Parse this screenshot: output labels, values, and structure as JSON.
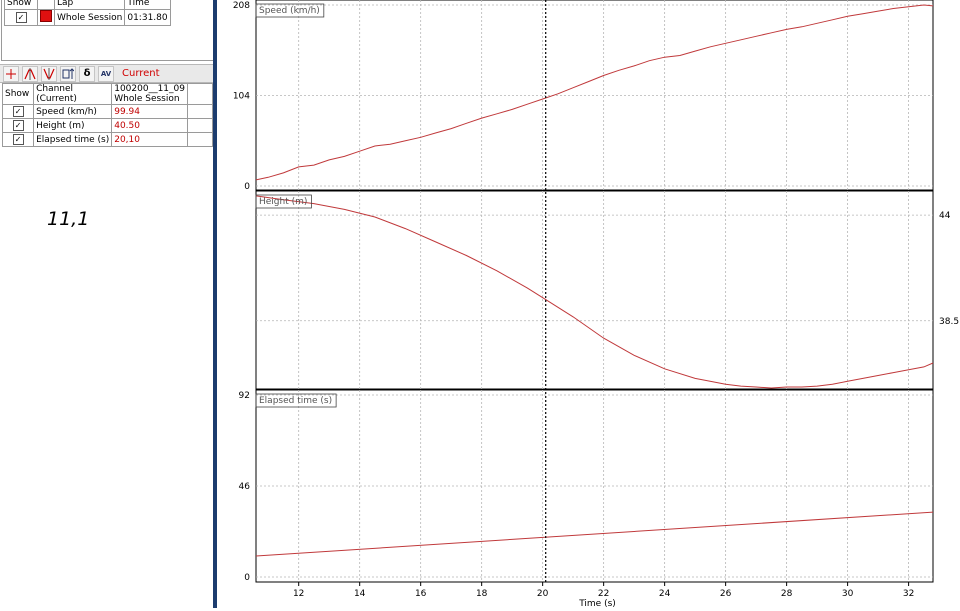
{
  "laps": {
    "headers": {
      "show": "Show",
      "lap": "Lap",
      "time": "Time"
    },
    "rows": [
      {
        "show": true,
        "color": "#e01010",
        "lap": "Whole Session",
        "time": "01:31.80"
      }
    ]
  },
  "toolbar": {
    "current_label": "Current",
    "delta_symbol": "δ",
    "av_symbol": "AV"
  },
  "channels": {
    "headers": {
      "show": "Show",
      "channel_line1": "Channel",
      "channel_line2": "(Current)",
      "session_line1": "100200__11_09",
      "session_line2": "Whole Session"
    },
    "rows": [
      {
        "name": "Speed (km/h)",
        "value": "99.94"
      },
      {
        "name": "Height (m)",
        "value": "40.50"
      },
      {
        "name": "Elapsed time (s)",
        "value": "20,10"
      }
    ]
  },
  "note": "11,1",
  "colors": {
    "trace": "#c0393b",
    "accent_divider": "#1c3c6e"
  },
  "chart_data": {
    "type": "line",
    "xlabel": "Time (s)",
    "x_ticks": [
      "12",
      "14",
      "16",
      "18",
      "20",
      "22",
      "24",
      "26",
      "28",
      "30",
      "32"
    ],
    "xlim": [
      10.6,
      32.8
    ],
    "cursor_x": 20.1,
    "panels": [
      {
        "label": "Speed (km/h)",
        "ylim": [
          0,
          208
        ],
        "y_ticks": [
          "0",
          "104",
          "208"
        ],
        "y_tick_values": [
          0,
          104,
          208
        ],
        "tick_side": "left",
        "x": [
          10.6,
          11.0,
          11.5,
          12.0,
          12.5,
          13.0,
          13.5,
          14.0,
          14.5,
          15.0,
          15.5,
          16.0,
          16.5,
          17.0,
          17.5,
          18.0,
          18.5,
          19.0,
          19.5,
          20.0,
          20.5,
          21.0,
          21.5,
          22.0,
          22.5,
          23.0,
          23.5,
          24.0,
          24.5,
          25.0,
          25.5,
          26.0,
          26.5,
          27.0,
          27.5,
          28.0,
          28.5,
          29.0,
          29.5,
          30.0,
          30.5,
          31.0,
          31.5,
          32.0,
          32.5,
          32.8
        ],
        "y": [
          7,
          10,
          15,
          22,
          24,
          30,
          34,
          40,
          46,
          48,
          52,
          56,
          61,
          66,
          72,
          78,
          83,
          88,
          94,
          100,
          106,
          113,
          120,
          127,
          133,
          138,
          144,
          148,
          150,
          155,
          160,
          164,
          168,
          172,
          176,
          180,
          183,
          187,
          191,
          195,
          198,
          201,
          204,
          206,
          208,
          207
        ]
      },
      {
        "label": "Height (m)",
        "ylim": [
          35.0,
          45.1
        ],
        "y_ticks": [
          "44",
          "38.5"
        ],
        "y_tick_values": [
          44,
          38.5
        ],
        "tick_side": "right",
        "x": [
          10.6,
          11.5,
          12.5,
          13.5,
          14.5,
          15.5,
          16.5,
          17.5,
          18.5,
          19.5,
          20.1,
          21.0,
          22.0,
          23.0,
          24.0,
          25.0,
          26.0,
          26.5,
          27.0,
          27.5,
          28.0,
          28.5,
          29.0,
          29.5,
          30.0,
          30.5,
          31.0,
          31.5,
          32.0,
          32.5,
          32.8
        ],
        "y": [
          45.0,
          44.8,
          44.6,
          44.3,
          43.9,
          43.3,
          42.6,
          41.9,
          41.1,
          40.2,
          39.6,
          38.7,
          37.6,
          36.7,
          36.0,
          35.5,
          35.2,
          35.1,
          35.05,
          35.0,
          35.05,
          35.05,
          35.1,
          35.2,
          35.35,
          35.5,
          35.65,
          35.8,
          35.95,
          36.1,
          36.3
        ]
      },
      {
        "label": "Elapsed time (s)",
        "ylim": [
          0,
          92
        ],
        "y_ticks": [
          "0",
          "46",
          "92"
        ],
        "y_tick_values": [
          0,
          46,
          92
        ],
        "tick_side": "left",
        "x": [
          10.6,
          32.8
        ],
        "y": [
          10.6,
          32.8
        ]
      }
    ]
  }
}
